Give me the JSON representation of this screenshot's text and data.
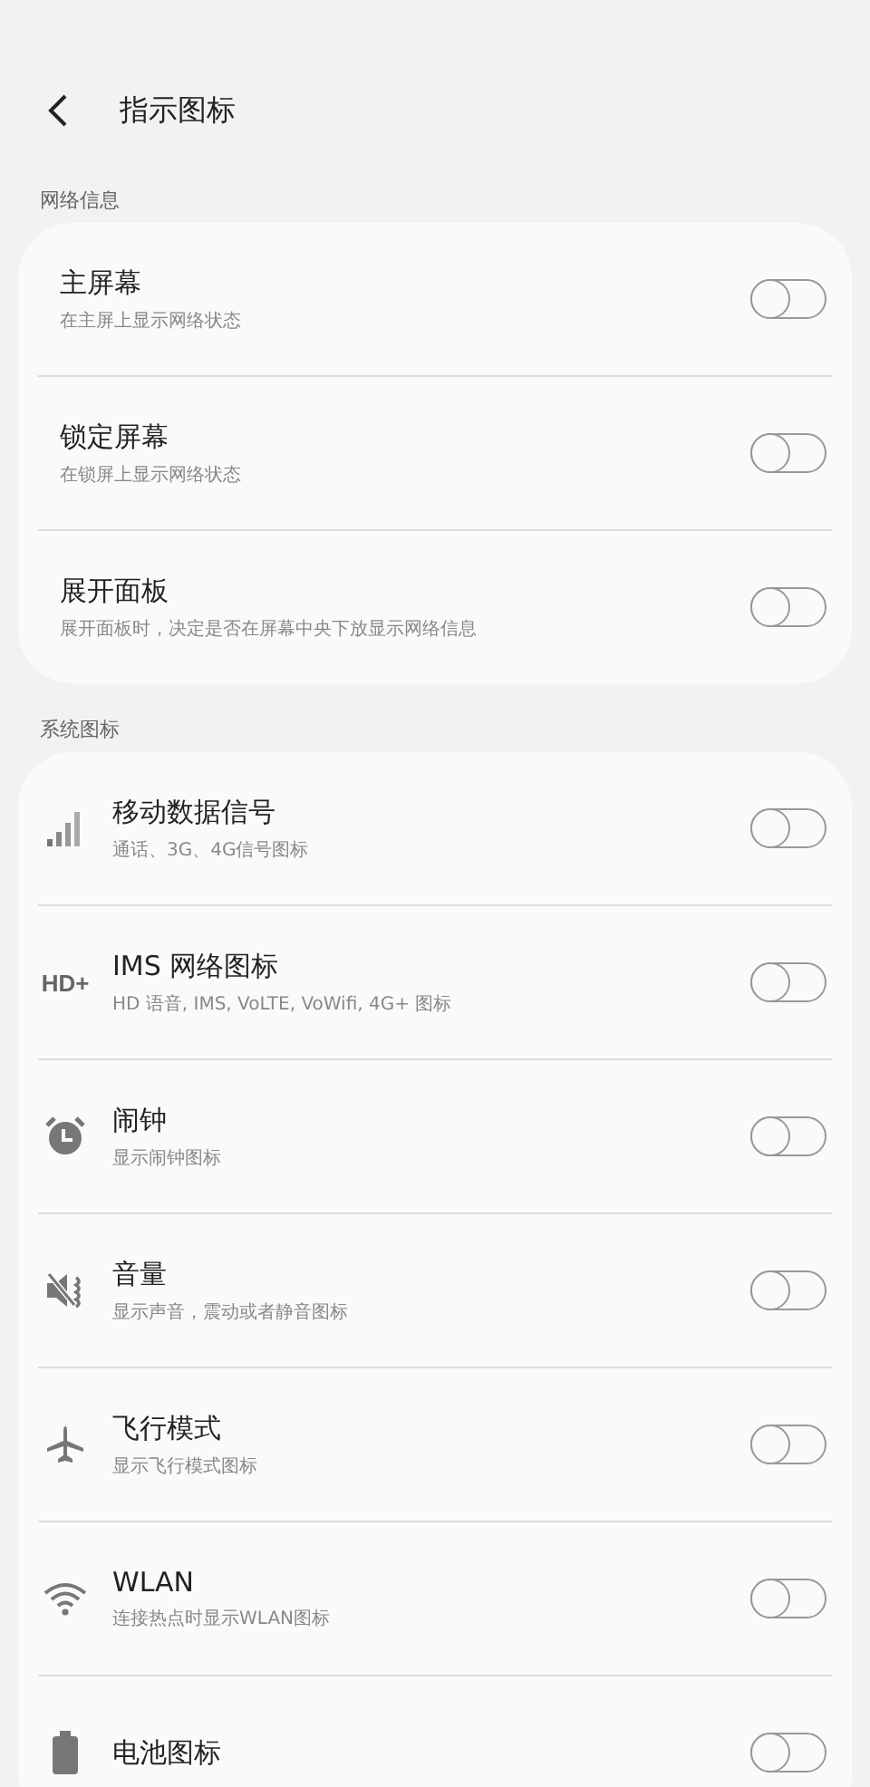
{
  "header": {
    "title": "指示图标"
  },
  "sections": [
    {
      "label": "网络信息",
      "items": [
        {
          "title": "主屏幕",
          "subtitle": "在主屏上显示网络状态",
          "on": false
        },
        {
          "title": "锁定屏幕",
          "subtitle": "在锁屏上显示网络状态",
          "on": false
        },
        {
          "title": "展开面板",
          "subtitle": "展开面板时，决定是否在屏幕中央下放显示网络信息",
          "on": false
        }
      ]
    },
    {
      "label": "系统图标",
      "items": [
        {
          "kind": "signal",
          "title": "移动数据信号",
          "subtitle": "通话、3G、4G信号图标",
          "on": false
        },
        {
          "kind": "hd",
          "icon_text": "HD+",
          "title": "IMS 网络图标",
          "subtitle": "HD 语音, IMS, VoLTE, VoWifi, 4G+ 图标",
          "on": false
        },
        {
          "kind": "alarm",
          "title": "闹钟",
          "subtitle": "显示闹钟图标",
          "on": false
        },
        {
          "kind": "mute",
          "title": "音量",
          "subtitle": "显示声音，震动或者静音图标",
          "on": false
        },
        {
          "kind": "airplane",
          "title": "飞行模式",
          "subtitle": "显示飞行模式图标",
          "on": false
        },
        {
          "kind": "wifi",
          "title": "WLAN",
          "subtitle": "连接热点时显示WLAN图标",
          "on": false
        },
        {
          "kind": "battery",
          "title": "电池图标",
          "on": false
        }
      ]
    }
  ]
}
